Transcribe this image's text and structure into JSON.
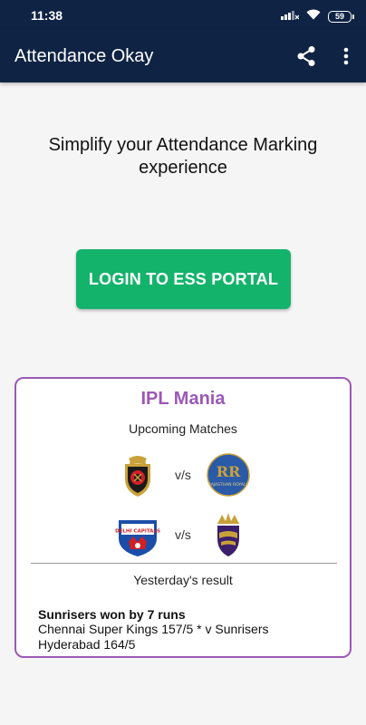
{
  "status_bar": {
    "time": "11:38",
    "battery": "59",
    "icons": [
      "signal-icon",
      "wifi-icon",
      "battery-icon"
    ]
  },
  "app_bar": {
    "title": "Attendance Okay",
    "actions": [
      "share-icon",
      "more-vert-icon"
    ],
    "color": "#0f2344"
  },
  "main": {
    "tagline": "Simplify your Attendance Marking experience",
    "login_button": "LOGIN TO ESS PORTAL",
    "accent_color": "#14b36b"
  },
  "ipl_card": {
    "title": "IPL Mania",
    "title_color": "#9b59b6",
    "upcoming_label": "Upcoming Matches",
    "matches": [
      {
        "home_logo": "rcb-logo",
        "vs": "v/s",
        "away_logo": "rajasthan-royals-logo",
        "away_logo_text": "RAJASTHAN ROYALS"
      },
      {
        "home_logo": "delhi-capitals-logo",
        "home_logo_text": "DELHI CAPITALS",
        "vs": "v/s",
        "away_logo": "kkr-logo"
      }
    ],
    "yesterday_label": "Yesterday's result",
    "result_headline": "Sunrisers won by 7 runs",
    "result_detail": "Chennai Super Kings 157/5 * v Sunrisers Hyderabad 164/5"
  }
}
